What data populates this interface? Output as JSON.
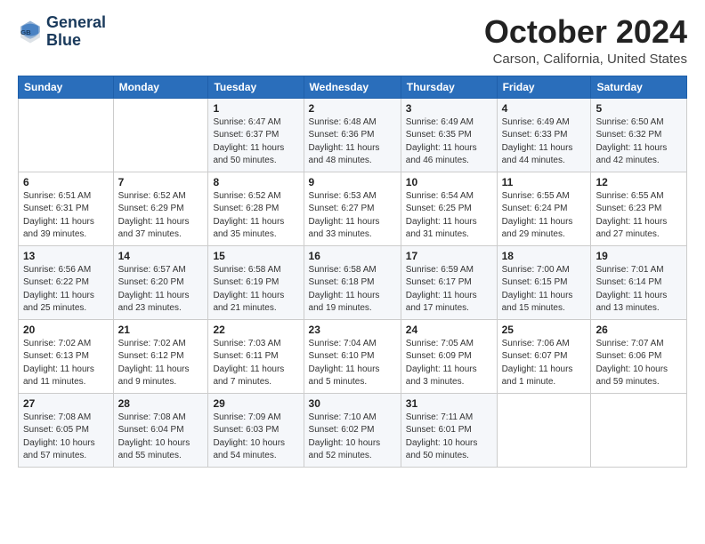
{
  "logo": {
    "line1": "General",
    "line2": "Blue"
  },
  "title": "October 2024",
  "location": "Carson, California, United States",
  "weekdays": [
    "Sunday",
    "Monday",
    "Tuesday",
    "Wednesday",
    "Thursday",
    "Friday",
    "Saturday"
  ],
  "weeks": [
    [
      {
        "day": "",
        "info": ""
      },
      {
        "day": "",
        "info": ""
      },
      {
        "day": "1",
        "info": "Sunrise: 6:47 AM\nSunset: 6:37 PM\nDaylight: 11 hours and 50 minutes."
      },
      {
        "day": "2",
        "info": "Sunrise: 6:48 AM\nSunset: 6:36 PM\nDaylight: 11 hours and 48 minutes."
      },
      {
        "day": "3",
        "info": "Sunrise: 6:49 AM\nSunset: 6:35 PM\nDaylight: 11 hours and 46 minutes."
      },
      {
        "day": "4",
        "info": "Sunrise: 6:49 AM\nSunset: 6:33 PM\nDaylight: 11 hours and 44 minutes."
      },
      {
        "day": "5",
        "info": "Sunrise: 6:50 AM\nSunset: 6:32 PM\nDaylight: 11 hours and 42 minutes."
      }
    ],
    [
      {
        "day": "6",
        "info": "Sunrise: 6:51 AM\nSunset: 6:31 PM\nDaylight: 11 hours and 39 minutes."
      },
      {
        "day": "7",
        "info": "Sunrise: 6:52 AM\nSunset: 6:29 PM\nDaylight: 11 hours and 37 minutes."
      },
      {
        "day": "8",
        "info": "Sunrise: 6:52 AM\nSunset: 6:28 PM\nDaylight: 11 hours and 35 minutes."
      },
      {
        "day": "9",
        "info": "Sunrise: 6:53 AM\nSunset: 6:27 PM\nDaylight: 11 hours and 33 minutes."
      },
      {
        "day": "10",
        "info": "Sunrise: 6:54 AM\nSunset: 6:25 PM\nDaylight: 11 hours and 31 minutes."
      },
      {
        "day": "11",
        "info": "Sunrise: 6:55 AM\nSunset: 6:24 PM\nDaylight: 11 hours and 29 minutes."
      },
      {
        "day": "12",
        "info": "Sunrise: 6:55 AM\nSunset: 6:23 PM\nDaylight: 11 hours and 27 minutes."
      }
    ],
    [
      {
        "day": "13",
        "info": "Sunrise: 6:56 AM\nSunset: 6:22 PM\nDaylight: 11 hours and 25 minutes."
      },
      {
        "day": "14",
        "info": "Sunrise: 6:57 AM\nSunset: 6:20 PM\nDaylight: 11 hours and 23 minutes."
      },
      {
        "day": "15",
        "info": "Sunrise: 6:58 AM\nSunset: 6:19 PM\nDaylight: 11 hours and 21 minutes."
      },
      {
        "day": "16",
        "info": "Sunrise: 6:58 AM\nSunset: 6:18 PM\nDaylight: 11 hours and 19 minutes."
      },
      {
        "day": "17",
        "info": "Sunrise: 6:59 AM\nSunset: 6:17 PM\nDaylight: 11 hours and 17 minutes."
      },
      {
        "day": "18",
        "info": "Sunrise: 7:00 AM\nSunset: 6:15 PM\nDaylight: 11 hours and 15 minutes."
      },
      {
        "day": "19",
        "info": "Sunrise: 7:01 AM\nSunset: 6:14 PM\nDaylight: 11 hours and 13 minutes."
      }
    ],
    [
      {
        "day": "20",
        "info": "Sunrise: 7:02 AM\nSunset: 6:13 PM\nDaylight: 11 hours and 11 minutes."
      },
      {
        "day": "21",
        "info": "Sunrise: 7:02 AM\nSunset: 6:12 PM\nDaylight: 11 hours and 9 minutes."
      },
      {
        "day": "22",
        "info": "Sunrise: 7:03 AM\nSunset: 6:11 PM\nDaylight: 11 hours and 7 minutes."
      },
      {
        "day": "23",
        "info": "Sunrise: 7:04 AM\nSunset: 6:10 PM\nDaylight: 11 hours and 5 minutes."
      },
      {
        "day": "24",
        "info": "Sunrise: 7:05 AM\nSunset: 6:09 PM\nDaylight: 11 hours and 3 minutes."
      },
      {
        "day": "25",
        "info": "Sunrise: 7:06 AM\nSunset: 6:07 PM\nDaylight: 11 hours and 1 minute."
      },
      {
        "day": "26",
        "info": "Sunrise: 7:07 AM\nSunset: 6:06 PM\nDaylight: 10 hours and 59 minutes."
      }
    ],
    [
      {
        "day": "27",
        "info": "Sunrise: 7:08 AM\nSunset: 6:05 PM\nDaylight: 10 hours and 57 minutes."
      },
      {
        "day": "28",
        "info": "Sunrise: 7:08 AM\nSunset: 6:04 PM\nDaylight: 10 hours and 55 minutes."
      },
      {
        "day": "29",
        "info": "Sunrise: 7:09 AM\nSunset: 6:03 PM\nDaylight: 10 hours and 54 minutes."
      },
      {
        "day": "30",
        "info": "Sunrise: 7:10 AM\nSunset: 6:02 PM\nDaylight: 10 hours and 52 minutes."
      },
      {
        "day": "31",
        "info": "Sunrise: 7:11 AM\nSunset: 6:01 PM\nDaylight: 10 hours and 50 minutes."
      },
      {
        "day": "",
        "info": ""
      },
      {
        "day": "",
        "info": ""
      }
    ]
  ]
}
